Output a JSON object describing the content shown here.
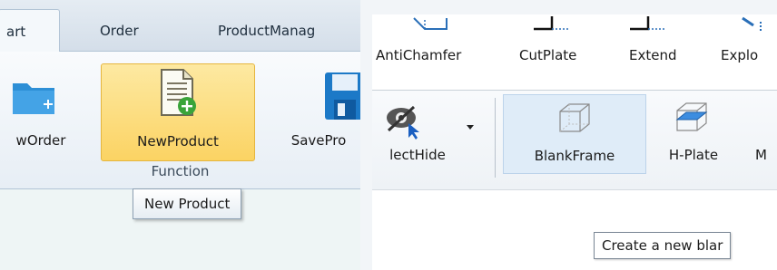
{
  "colors": {
    "ribbon_tab_bg": "#d4dee9",
    "highlight_fill": "#fbd363",
    "highlight_border": "#e5b53e",
    "folder_blue": "#2d8fd6",
    "save_blue": "#1c79c7",
    "doc_green": "#3aa43a",
    "hover_blue": "#dfecf8",
    "eye_dark": "#555555",
    "cursor_blue": "#1a5fc1",
    "plate_blue": "#3c8de0"
  },
  "left_panel": {
    "tabs": [
      {
        "label": "art",
        "active": true
      },
      {
        "label": "Order",
        "active": false
      },
      {
        "label": "ProductManag",
        "active": false
      }
    ],
    "buttons": [
      {
        "label": "wOrder",
        "icon": "new-order-folder-icon"
      },
      {
        "label": "NewProduct",
        "icon": "new-product-document-icon",
        "highlighted": true
      },
      {
        "label": "SavePro",
        "icon": "save-disk-icon"
      }
    ],
    "group_label": "Function",
    "tooltip": "New Product"
  },
  "right_panel": {
    "top_tools": [
      {
        "label": "AntiChamfer",
        "icon": "anti-chamfer-icon"
      },
      {
        "label": "CutPlate",
        "icon": "cut-plate-icon"
      },
      {
        "label": "Extend",
        "icon": "extend-icon"
      },
      {
        "label": "Explo",
        "icon": "explode-icon"
      }
    ],
    "tools": [
      {
        "label": "lectHide",
        "icon": "select-hide-eye-icon",
        "has_dropdown": true
      },
      {
        "label": "BlankFrame",
        "icon": "blank-frame-icon",
        "hovered": true
      },
      {
        "label": "H-Plate",
        "icon": "h-plate-icon"
      },
      {
        "label": "M",
        "icon": "more-icon"
      }
    ],
    "tooltip": "Create a new blar"
  }
}
